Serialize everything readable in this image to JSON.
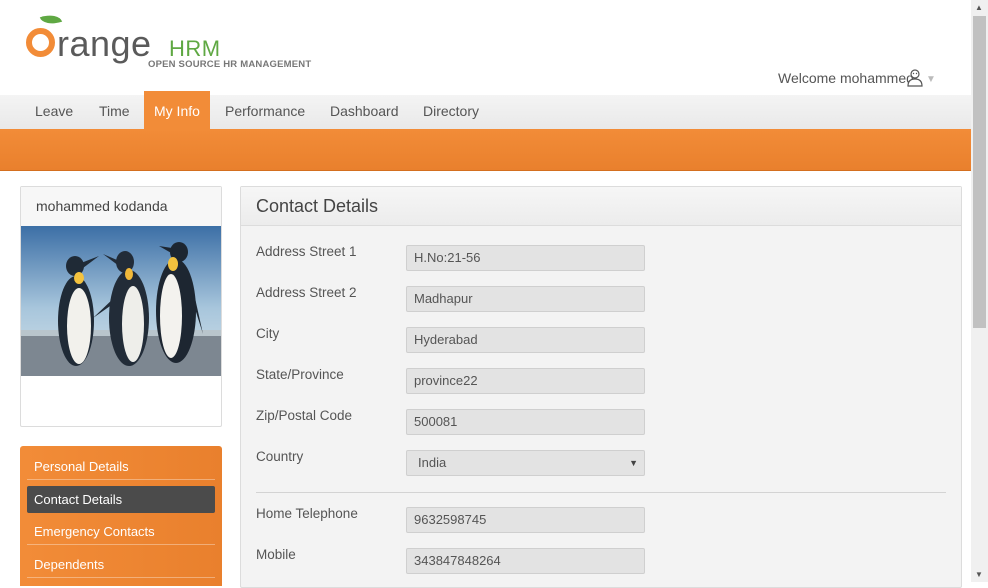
{
  "header": {
    "logo_word": "range",
    "logo_hrm": "HRM",
    "logo_tagline": "OPEN SOURCE HR MANAGEMENT",
    "welcome_text": "Welcome mohammed"
  },
  "nav": {
    "items": [
      {
        "label": "Leave"
      },
      {
        "label": "Time"
      },
      {
        "label": "My Info"
      },
      {
        "label": "Performance"
      },
      {
        "label": "Dashboard"
      },
      {
        "label": "Directory"
      }
    ],
    "active_index": 2
  },
  "profile": {
    "name": "mohammed kodanda"
  },
  "side_menu": {
    "items": [
      {
        "label": "Personal Details"
      },
      {
        "label": "Contact Details"
      },
      {
        "label": "Emergency Contacts"
      },
      {
        "label": "Dependents"
      }
    ],
    "active_index": 1
  },
  "contact": {
    "title": "Contact Details",
    "fields": [
      {
        "label": "Address Street 1",
        "value": "H.No:21-56"
      },
      {
        "label": "Address Street 2",
        "value": "Madhapur"
      },
      {
        "label": "City",
        "value": "Hyderabad"
      },
      {
        "label": "State/Province",
        "value": "province22"
      },
      {
        "label": "Zip/Postal Code",
        "value": "500081"
      },
      {
        "label": "Country",
        "value": "India"
      },
      {
        "label": "Home Telephone",
        "value": "9632598745"
      },
      {
        "label": "Mobile",
        "value": "343847848264"
      }
    ]
  },
  "colors": {
    "brand_orange": "#f28c38",
    "brand_green": "#5fa843",
    "active_side": "#4b4b4b"
  },
  "icons": [
    "orangehrm-logo",
    "user-icon",
    "chevron-down-icon",
    "select-arrow-icon"
  ]
}
